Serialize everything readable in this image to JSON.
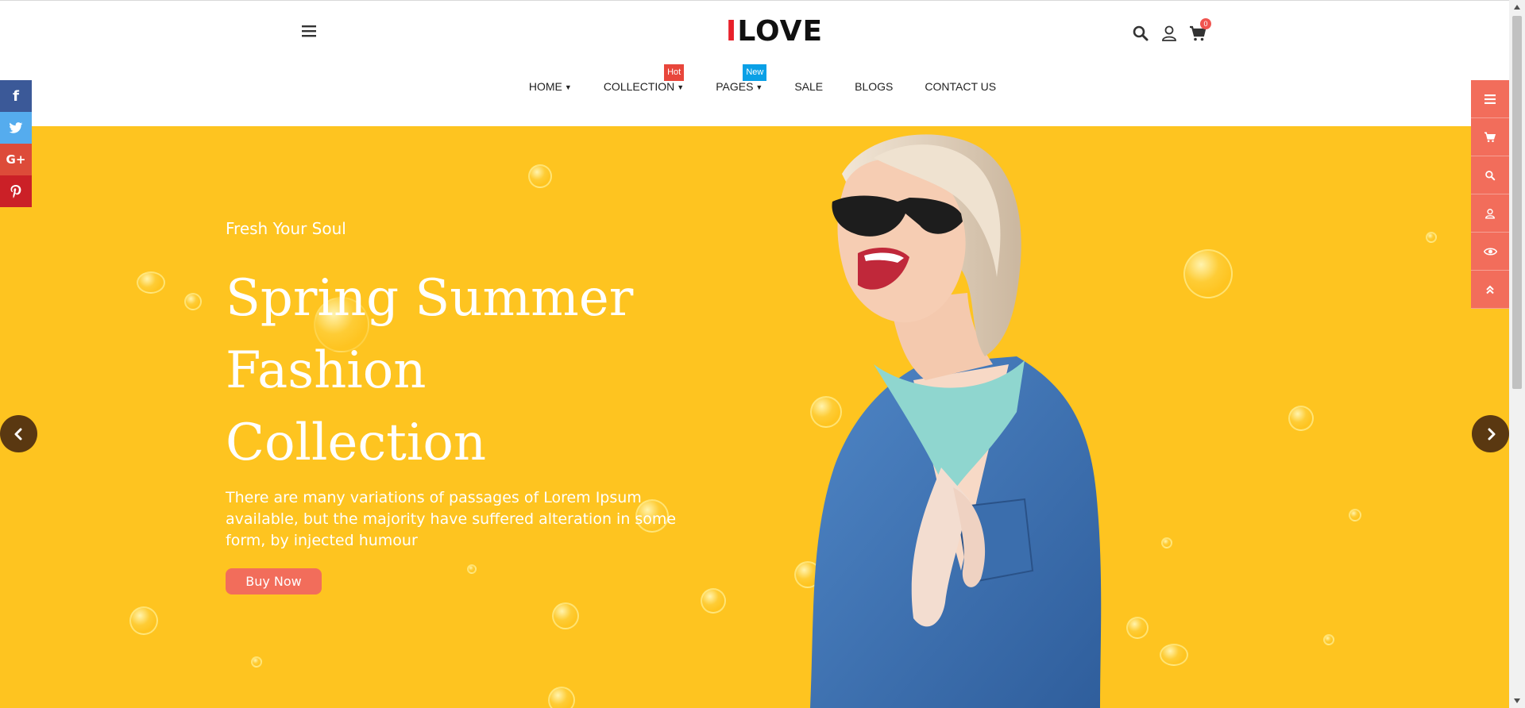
{
  "header": {
    "logo_mark": "I",
    "logo_text": "LOVE",
    "cart_count": "0"
  },
  "nav": [
    {
      "label": "HOME",
      "dropdown": true
    },
    {
      "label": "COLLECTION",
      "dropdown": true,
      "badge": "Hot"
    },
    {
      "label": "PAGES",
      "dropdown": true,
      "badge": "New"
    },
    {
      "label": "SALE",
      "dropdown": false
    },
    {
      "label": "BLOGS",
      "dropdown": false
    },
    {
      "label": "CONTACT US",
      "dropdown": false
    }
  ],
  "hero": {
    "subtitle": "Fresh Your Soul",
    "title_lines": [
      "Spring Summer",
      "Fashion",
      "Collection"
    ],
    "description": "There are many variations of passages of Lorem Ipsum available, but the majority have suffered alteration in some form, by injected humour",
    "button_label": "Buy Now"
  },
  "social": [
    {
      "name": "facebook",
      "glyph": "f"
    },
    {
      "name": "twitter",
      "glyph": "t"
    },
    {
      "name": "google-plus",
      "glyph": "G+"
    },
    {
      "name": "pinterest",
      "glyph": "P"
    }
  ],
  "tools": [
    "menu-icon",
    "cart-icon",
    "search-icon",
    "user-icon",
    "eye-icon",
    "double-chevron-up-icon"
  ],
  "colors": {
    "hero_bg": "#fec420",
    "accent": "#f26d5b",
    "logo_accent": "#e8202a",
    "hot_badge": "#e8463b",
    "new_badge": "#0aa0e6",
    "arrow_bg": "#5a3811"
  }
}
